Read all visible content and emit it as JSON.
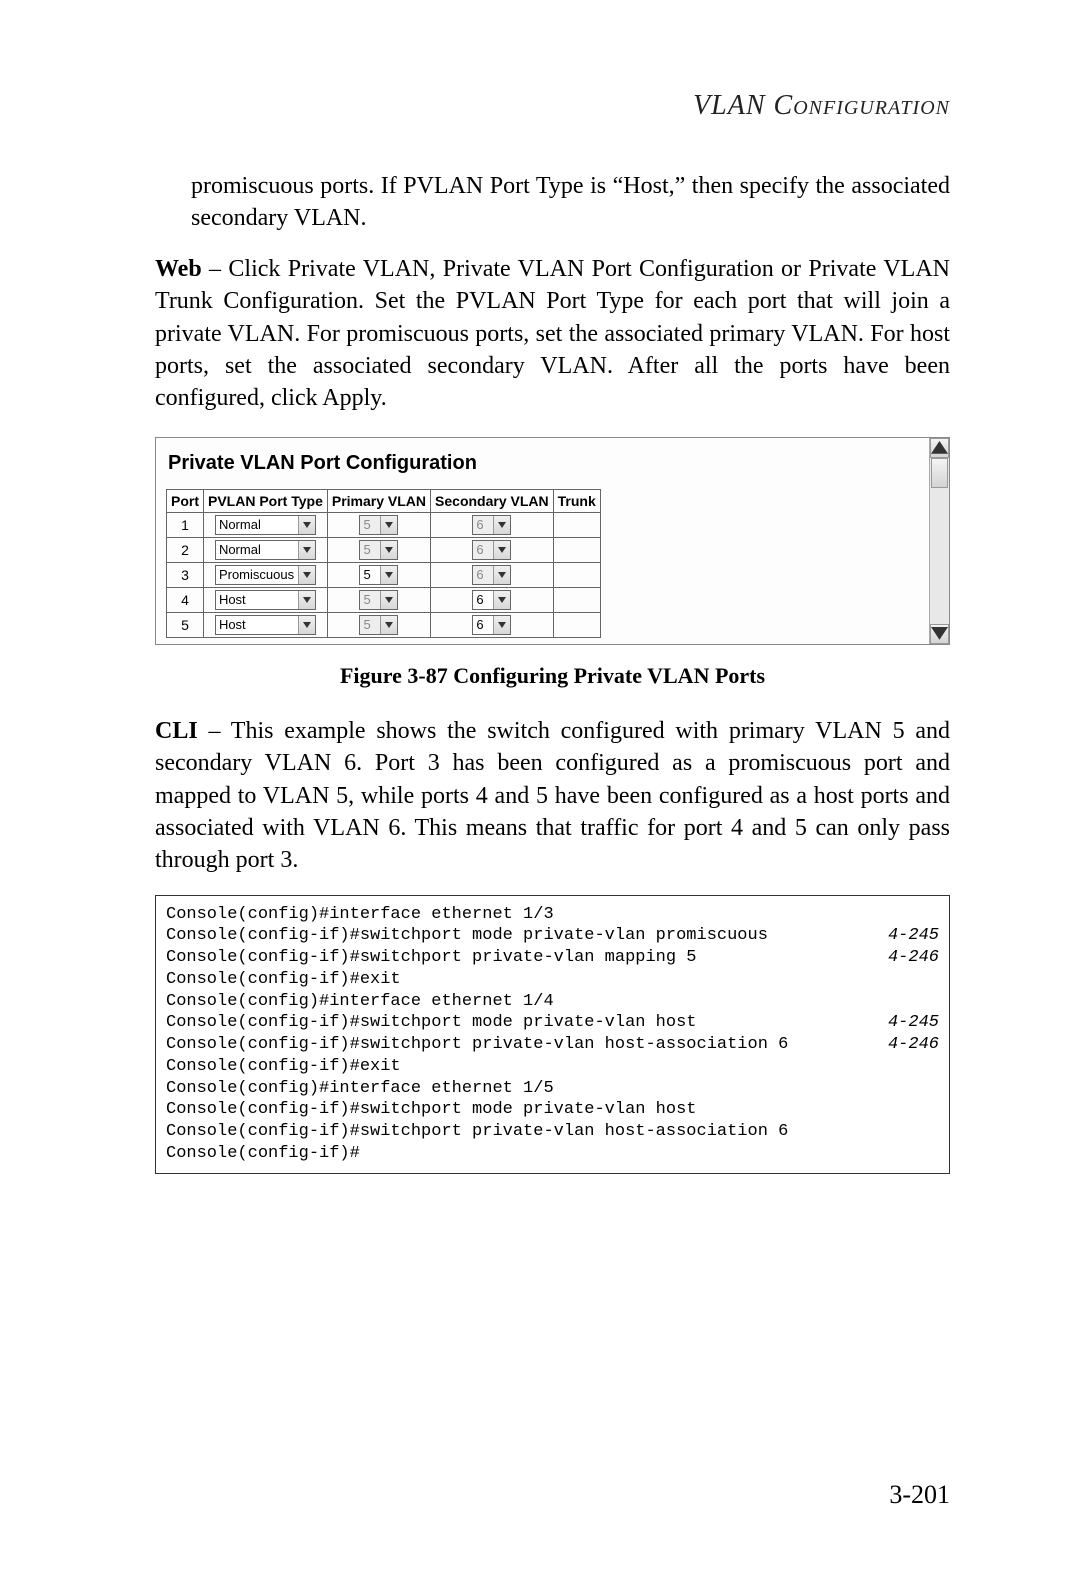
{
  "header": {
    "title": "VLAN Configuration"
  },
  "para1": "promiscuous ports. If PVLAN Port Type is “Host,” then specify the associated secondary VLAN.",
  "para2_lead": "Web",
  "para2_body": " – Click Private VLAN, Private VLAN Port Configuration or Private VLAN Trunk Configuration. Set the PVLAN Port Type for each port that will join a private VLAN. For promiscuous ports, set the associated primary VLAN. For host ports, set the associated secondary VLAN. After all the ports have been configured, click Apply.",
  "screenshot": {
    "title": "Private VLAN Port Configuration",
    "columns": [
      "Port",
      "PVLAN Port Type",
      "Primary VLAN",
      "Secondary VLAN",
      "Trunk"
    ],
    "rows": [
      {
        "port": "1",
        "type": "Normal",
        "primary": "5",
        "primary_enabled": false,
        "secondary": "6",
        "secondary_enabled": false,
        "trunk": ""
      },
      {
        "port": "2",
        "type": "Normal",
        "primary": "5",
        "primary_enabled": false,
        "secondary": "6",
        "secondary_enabled": false,
        "trunk": ""
      },
      {
        "port": "3",
        "type": "Promiscuous",
        "primary": "5",
        "primary_enabled": true,
        "secondary": "6",
        "secondary_enabled": false,
        "trunk": ""
      },
      {
        "port": "4",
        "type": "Host",
        "primary": "5",
        "primary_enabled": false,
        "secondary": "6",
        "secondary_enabled": true,
        "trunk": ""
      },
      {
        "port": "5",
        "type": "Host",
        "primary": "5",
        "primary_enabled": false,
        "secondary": "6",
        "secondary_enabled": true,
        "trunk": ""
      }
    ]
  },
  "figure_caption": "Figure 3-87   Configuring Private VLAN Ports",
  "para3_lead": "CLI",
  "para3_body": " – This example shows the switch configured with primary VLAN 5 and secondary VLAN 6. Port 3 has been configured as a promiscuous port and mapped to VLAN 5, while ports 4 and 5 have been configured as a host ports and associated with VLAN 6. This means that traffic for port 4 and 5 can only pass through port 3.",
  "cli": [
    {
      "cmd": "Console(config)#interface ethernet 1/3",
      "ref": ""
    },
    {
      "cmd": "Console(config-if)#switchport mode private-vlan promiscuous",
      "ref": "4-245"
    },
    {
      "cmd": "Console(config-if)#switchport private-vlan mapping 5",
      "ref": "4-246"
    },
    {
      "cmd": "Console(config-if)#exit",
      "ref": ""
    },
    {
      "cmd": "Console(config)#interface ethernet 1/4",
      "ref": ""
    },
    {
      "cmd": "Console(config-if)#switchport mode private-vlan host",
      "ref": "4-245"
    },
    {
      "cmd": "Console(config-if)#switchport private-vlan host-association 6",
      "ref": "4-246"
    },
    {
      "cmd": "Console(config-if)#exit",
      "ref": ""
    },
    {
      "cmd": "Console(config)#interface ethernet 1/5",
      "ref": ""
    },
    {
      "cmd": "Console(config-if)#switchport mode private-vlan host",
      "ref": ""
    },
    {
      "cmd": "Console(config-if)#switchport private-vlan host-association 6",
      "ref": ""
    },
    {
      "cmd": "Console(config-if)#",
      "ref": ""
    }
  ],
  "page_number": "3-201"
}
